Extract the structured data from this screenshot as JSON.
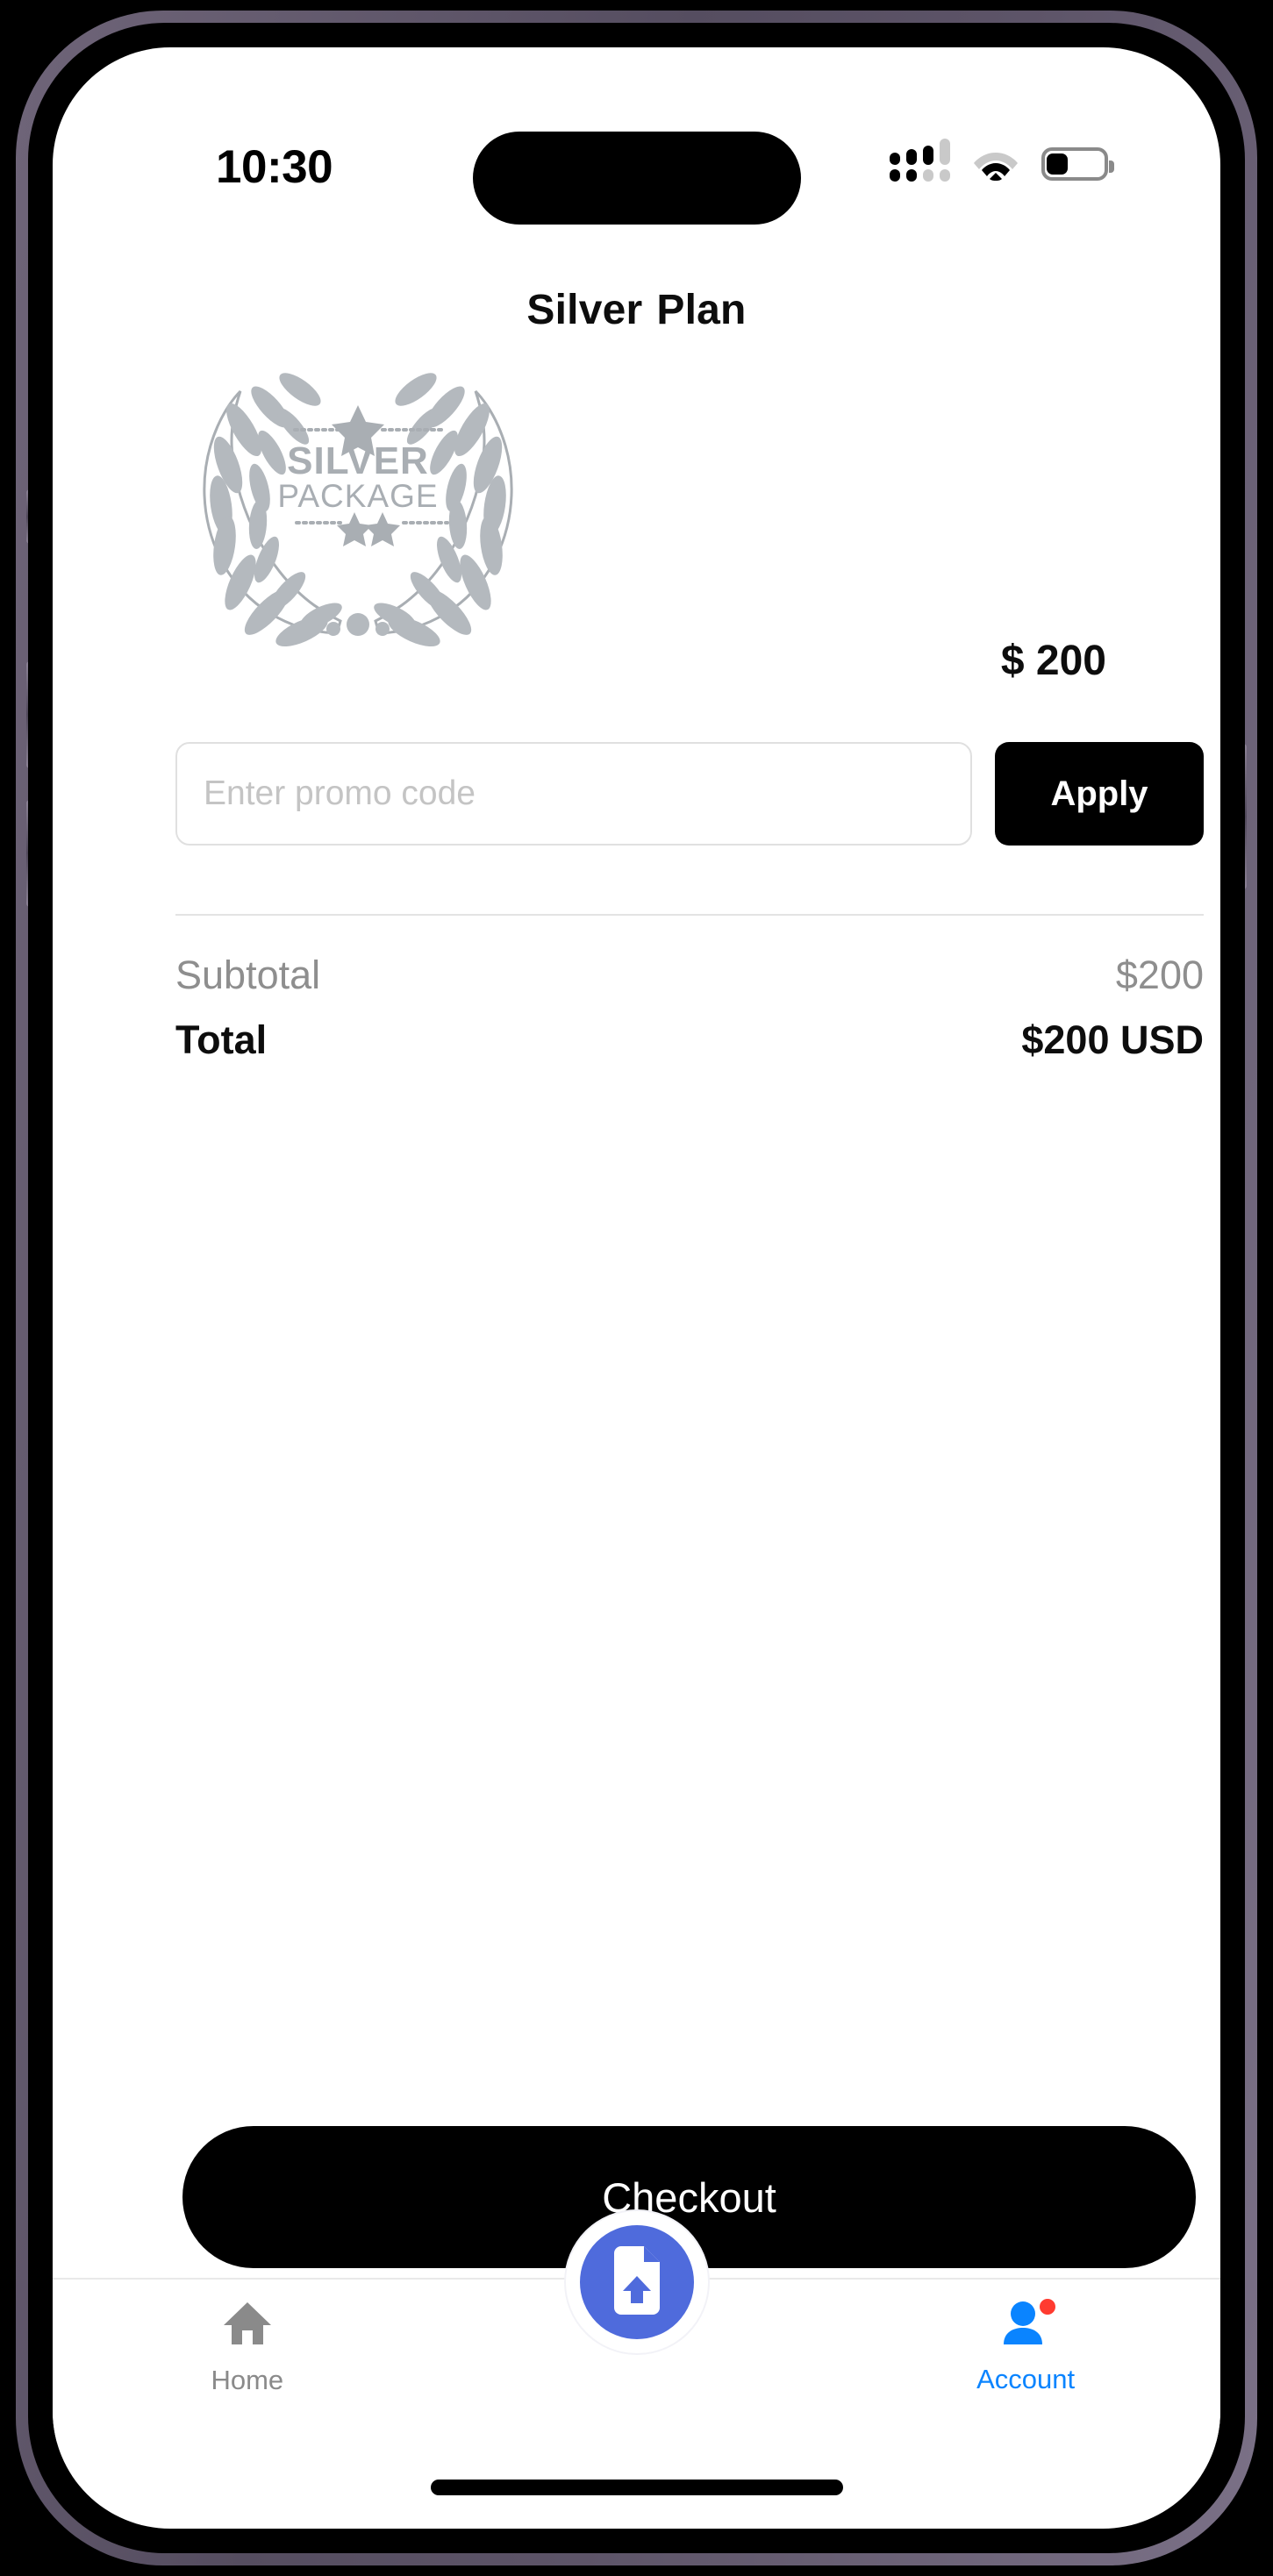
{
  "status_bar": {
    "time": "10:30",
    "signal_icon": "cellular-signal-icon",
    "wifi_icon": "wifi-icon",
    "battery_icon": "battery-low-icon",
    "battery_level_percent": 25
  },
  "header": {
    "title_first": "Silver",
    "title_second": "Plan"
  },
  "plan_badge": {
    "icon": "laurel-wreath-badge-icon",
    "line1": "SILVER",
    "line2": "PACKAGE",
    "top_star_icon": "star-icon",
    "bottom_star_icons": [
      "star-icon",
      "star-icon"
    ],
    "color": "#b0b5ba"
  },
  "price": {
    "display": "$ 200",
    "currency_symbol": "$",
    "amount": 200
  },
  "promo": {
    "placeholder": "Enter promo code",
    "value": "",
    "apply_label": "Apply"
  },
  "summary": {
    "rows": [
      {
        "label": "Subtotal",
        "value": "$200"
      },
      {
        "label": "Total",
        "value": "$200 USD"
      }
    ]
  },
  "checkout": {
    "label": "Checkout"
  },
  "tab_bar": {
    "items": [
      {
        "label": "Home",
        "icon": "home-icon",
        "active": false,
        "color": "#8a8a8a"
      },
      {
        "label": "Account",
        "icon": "person-icon",
        "active": true,
        "color": "#0a84ff",
        "badge": true
      }
    ],
    "fab": {
      "icon": "document-upload-icon",
      "color": "#4f6bdc"
    }
  },
  "colors": {
    "accent_blue": "#0a84ff",
    "fab_blue": "#4f6bdc",
    "badge_red": "#ff3b30",
    "silver": "#b0b5ba",
    "black": "#000000"
  }
}
